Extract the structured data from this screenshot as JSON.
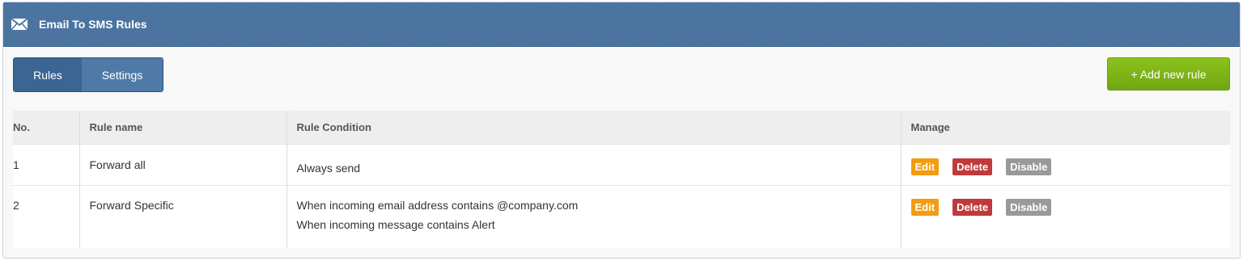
{
  "header": {
    "title": "Email To SMS Rules",
    "icon": "envelope-icon"
  },
  "tabs": [
    {
      "label": "Rules",
      "active": true
    },
    {
      "label": "Settings",
      "active": false
    }
  ],
  "add_button": {
    "label": "+ Add new rule"
  },
  "table": {
    "columns": [
      "No.",
      "Rule name",
      "Rule Condition",
      "Manage"
    ],
    "rows": [
      {
        "no": "1",
        "name": "Forward all",
        "conditions": [
          "Always send"
        ]
      },
      {
        "no": "2",
        "name": "Forward Specific",
        "conditions": [
          "When incoming email address contains @company.com",
          "When incoming message contains Alert"
        ]
      }
    ],
    "actions": {
      "edit": "Edit",
      "delete": "Delete",
      "disable": "Disable"
    }
  },
  "colors": {
    "header": "#4b74a0",
    "tab_active": "#3b6592",
    "add": "#7cb518",
    "edit": "#f39c12",
    "delete": "#c0393b",
    "disable": "#999999"
  }
}
